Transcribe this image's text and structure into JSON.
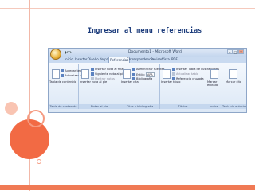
{
  "slide": {
    "title": "Ingresar  al  menu referencias",
    "colors": {
      "accent": "#f07a55",
      "title": "#1a3a7a"
    }
  },
  "word": {
    "window_title": "Documento1 - Microsoft Word",
    "tabs": [
      {
        "label": "Inicio"
      },
      {
        "label": "Insertar"
      },
      {
        "label": "Diseño de página"
      },
      {
        "label": "Referencias",
        "active": true
      },
      {
        "label": "Correspondencia"
      },
      {
        "label": "Revisar"
      },
      {
        "label": "Vista"
      },
      {
        "label": "PDF"
      }
    ],
    "groups": {
      "toc": {
        "label": "Tabla de contenido",
        "big_button": "Tabla de contenido",
        "items": [
          "Agregar texto",
          "Actualizar tabla"
        ]
      },
      "footnotes": {
        "label": "Notas al pie",
        "big_button": "Insertar nota al pie",
        "items": [
          "Insertar nota al final",
          "Siguiente nota al pie",
          "Mostrar notas"
        ]
      },
      "citations": {
        "label": "Citas y bibliografía",
        "big_button": "Insertar cita",
        "items": [
          "Administrar fuentes",
          "Estilo:",
          "Bibliografía"
        ],
        "style_value": "APA"
      },
      "captions": {
        "label": "Títulos",
        "big_button": "Insertar título",
        "items": [
          "Insertar Tabla de ilustraciones",
          "Actualizar tabla",
          "Referencia cruzada"
        ]
      },
      "index": {
        "label": "Índice",
        "big_button": "Marcar entrada"
      },
      "authorities": {
        "label": "Tabla de autoridades",
        "big_button": "Marcar cita"
      }
    }
  }
}
